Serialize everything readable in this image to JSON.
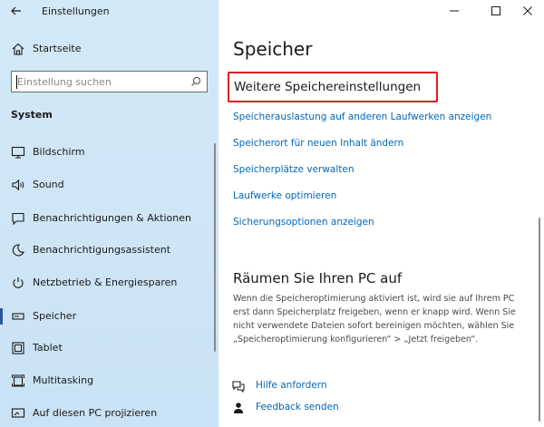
{
  "window": {
    "title": "Einstellungen",
    "controls": [
      "minimize-icon",
      "maximize-icon",
      "close-icon"
    ]
  },
  "sidebar": {
    "home_label": "Startseite",
    "search": {
      "placeholder": "Einstellung suchen",
      "value": ""
    },
    "section_label": "System",
    "items": [
      {
        "label": "Bildschirm",
        "icon": "monitor-icon"
      },
      {
        "label": "Sound",
        "icon": "speaker-icon"
      },
      {
        "label": "Benachrichtigungen & Aktionen",
        "icon": "notification-icon"
      },
      {
        "label": "Benachrichtigungsassistent",
        "icon": "moon-icon"
      },
      {
        "label": "Netzbetrieb & Energiesparen",
        "icon": "power-icon"
      },
      {
        "label": "Speicher",
        "icon": "storage-icon",
        "active": true
      },
      {
        "label": "Tablet",
        "icon": "tablet-icon"
      },
      {
        "label": "Multitasking",
        "icon": "multitasking-icon"
      },
      {
        "label": "Auf diesen PC projizieren",
        "icon": "projector-icon"
      }
    ]
  },
  "main": {
    "page_title": "Speicher",
    "more_settings": {
      "title": "Weitere Speichereinstellungen",
      "links": [
        "Speicherauslastung auf anderen Laufwerken anzeigen",
        "Speicherort für neuen Inhalt ändern",
        "Speicherplätze verwalten",
        "Laufwerke optimieren",
        "Sicherungsoptionen anzeigen"
      ]
    },
    "cleanup": {
      "title": "Räumen Sie Ihren PC auf",
      "description": "Wenn die Speicheroptimierung aktiviert ist, wird sie auf Ihrem PC erst dann Speicherplatz freigeben, wenn er knapp wird. Wenn Sie nicht verwendete Dateien sofort bereinigen möchten, wählen Sie „Speicheroptimierung konfigurieren“ > „Jetzt freigeben“."
    },
    "help": {
      "get_help": "Hilfe anfordern",
      "feedback": "Feedback senden"
    }
  },
  "colors": {
    "sidebar_bg": "#cfe6f6",
    "link": "#0067b8",
    "highlight": "#e01e1e",
    "active_accent": "#2b5797"
  }
}
